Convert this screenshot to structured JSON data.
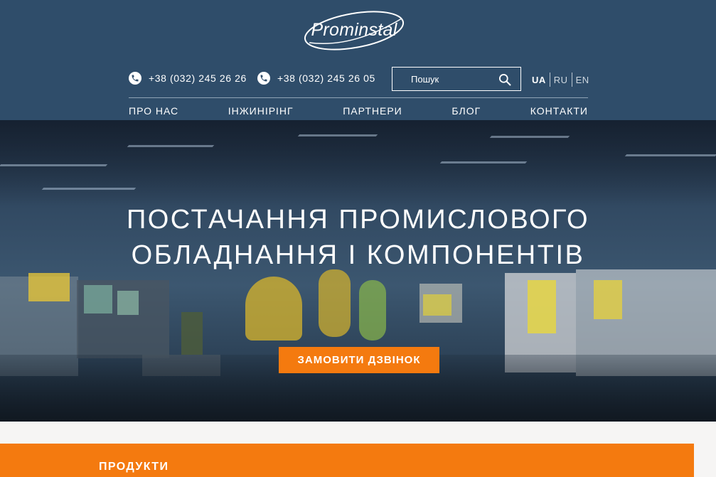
{
  "brand": {
    "logo_text": "Prominstal"
  },
  "contacts": {
    "phone_1": "+38 (032) 245 26 26",
    "phone_2": "+38 (032) 245 26 05"
  },
  "search": {
    "placeholder": "Пошук"
  },
  "languages": {
    "items": [
      "UA",
      "RU",
      "EN"
    ],
    "active": "UA"
  },
  "nav": {
    "items": [
      {
        "label": "ПРО НАС"
      },
      {
        "label": "ІНЖИНІРІНГ"
      },
      {
        "label": "ПАРТНЕРИ"
      },
      {
        "label": "БЛОГ"
      },
      {
        "label": "КОНТАКТИ"
      }
    ]
  },
  "hero": {
    "title_line_1": "ПОСТАЧАННЯ ПРОМИСЛОВОГО",
    "title_line_2": "ОБЛАДНАННЯ І КОМПОНЕНТІВ",
    "cta_label": "ЗАМОВИТИ ДЗВІНОК"
  },
  "section": {
    "products_label": "ПРОДУКТИ"
  },
  "colors": {
    "header_bg": "#2f4d6a",
    "accent": "#f47a0f",
    "text_light": "#ffffff"
  }
}
